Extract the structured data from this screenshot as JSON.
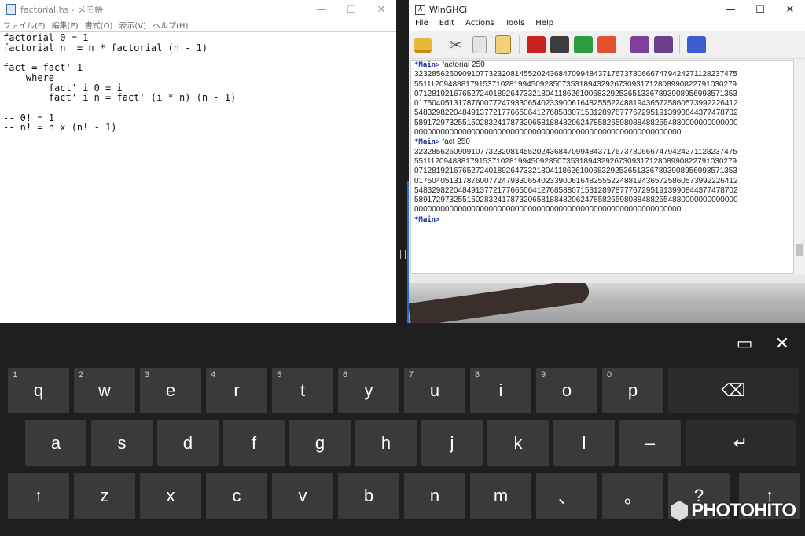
{
  "notepad": {
    "title": "factorial.hs - メモ帳",
    "menu": [
      "ファイル(F)",
      "編集(E)",
      "書式(O)",
      "表示(V)",
      "ヘルプ(H)"
    ],
    "code": "factorial 0 = 1\nfactorial n  = n * factorial (n - 1)\n\nfact = fact' 1\n    where\n        fact' i 0 = i\n        fact' i n = fact' (i * n) (n - 1)\n\n-- 0! = 1\n-- n! = n x (n! - 1)"
  },
  "winghci": {
    "title": "WinGHCi",
    "menu": [
      "File",
      "Edit",
      "Actions",
      "Tools",
      "Help"
    ],
    "toolbar_icons": [
      "open-folder-icon",
      "cut-icon",
      "copy-icon",
      "paste-icon",
      "run-icon",
      "pause-icon",
      "reload-icon",
      "edit-icon",
      "settings-icon",
      "tools-icon",
      "help-icon"
    ],
    "prompt": "*Main>",
    "cmd1": "factorial 250",
    "cmd2": "fact 250",
    "result_lines": [
      "32328562609091077323208145520243684709948437176737806667479424271128237475",
      "55111209488817915371028199450928507353189432926730931712808990822791030279",
      "07128192167652724018926473321804118626100683292536513367893908956993571353",
      "01750405131787600772479330654023390061648255522488194365725860573992226412",
      "54832982204849137721776650641276858807153128978777672951913990844377478702",
      "58917297325515028324178732065818848206247858265980884882554880000000000000",
      "0000000000000000000000000000000000000000000000000000000000000"
    ]
  },
  "keyboard": {
    "row1": [
      {
        "num": "1",
        "ch": "q"
      },
      {
        "num": "2",
        "ch": "w"
      },
      {
        "num": "3",
        "ch": "e"
      },
      {
        "num": "4",
        "ch": "r"
      },
      {
        "num": "5",
        "ch": "t"
      },
      {
        "num": "6",
        "ch": "y"
      },
      {
        "num": "7",
        "ch": "u"
      },
      {
        "num": "8",
        "ch": "i"
      },
      {
        "num": "9",
        "ch": "o"
      },
      {
        "num": "0",
        "ch": "p"
      }
    ],
    "row2": [
      "a",
      "s",
      "d",
      "f",
      "g",
      "h",
      "j",
      "k",
      "l",
      "–"
    ],
    "row3": [
      "z",
      "x",
      "c",
      "v",
      "b",
      "n",
      "m",
      "、",
      "。",
      "?"
    ],
    "backspace": "⌫",
    "enter": "↵",
    "shift": "↑",
    "dock_icon": "▭",
    "close_icon": "✕"
  },
  "watermark": "PHOTOHITO"
}
